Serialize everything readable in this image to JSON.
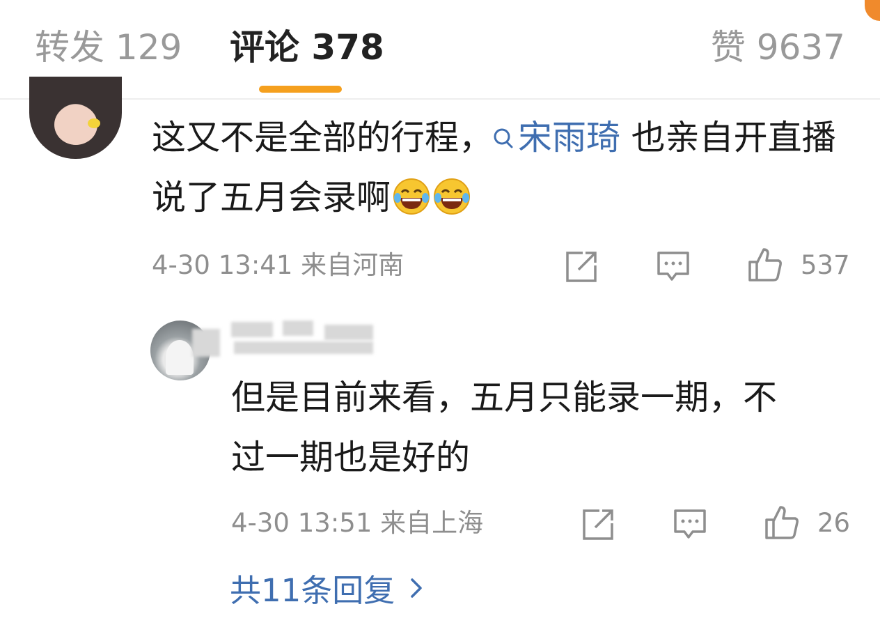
{
  "tabs": {
    "repost": "转发 129",
    "comments": "评论 378",
    "likes": "赞 9637",
    "active_color": "#f5a01e"
  },
  "comment": {
    "text_before": "这又不是全部的行程，",
    "mention": "宋雨琦",
    "text_after": " 也亲自开直播说了五月会录啊",
    "emoji": [
      "laughing-tears-emoji",
      "laughing-tears-emoji"
    ],
    "meta": "4-30 13:41 来自河南",
    "like_count": "537"
  },
  "reply": {
    "text": "但是目前来看，五月只能录一期，不过一期也是好的",
    "meta": "4-30 13:51 来自上海",
    "like_count": "26"
  },
  "more_replies": "共11条回复",
  "colors": {
    "link": "#3f6eb0",
    "meta": "#8e8e8e",
    "text": "#1a1a1a"
  }
}
